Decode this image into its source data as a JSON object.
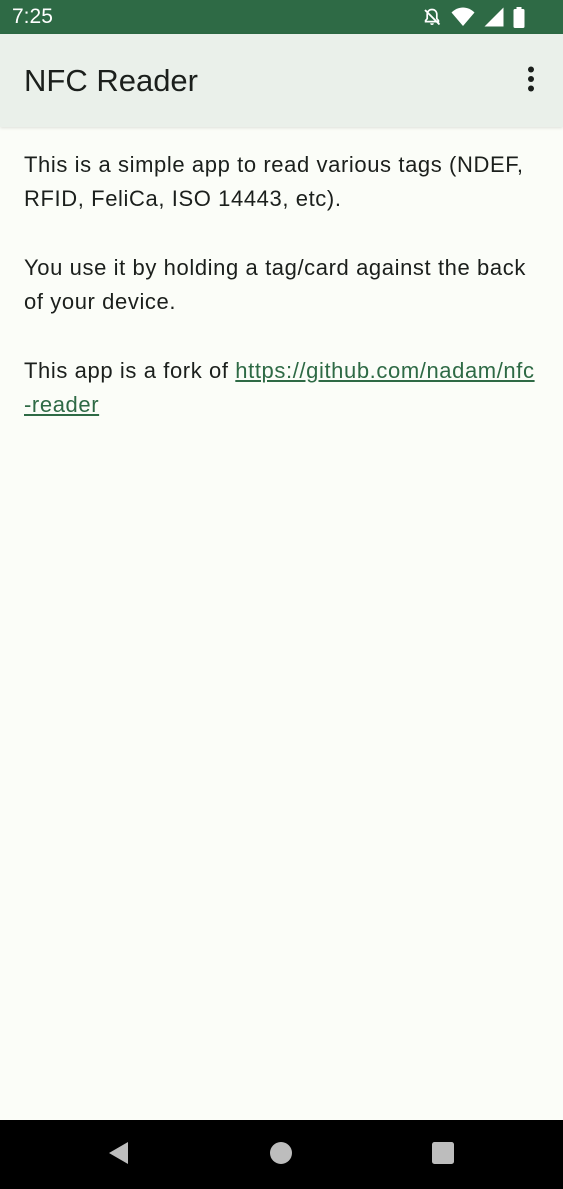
{
  "status_bar": {
    "time": "7:25",
    "icons": [
      "notifications-off-icon",
      "wifi-icon",
      "cell-signal-icon",
      "battery-icon"
    ]
  },
  "app_bar": {
    "title": "NFC Reader",
    "overflow_icon": "more-vert-icon"
  },
  "content": {
    "paragraph_1": "This is a simple app to read various tags (NDEF, RFID, FeliCa, ISO 14443, etc).",
    "paragraph_2": "You use it by holding a tag/card against the back of your device.",
    "paragraph_3_prefix": "This app is a fork of ",
    "paragraph_3_link": "https://github.com/nadam/nfc-reader"
  },
  "nav_bar": {
    "icons": [
      "back-icon",
      "home-icon",
      "recents-icon"
    ]
  },
  "colors": {
    "status_bar": "#2e6a45",
    "app_bar": "#eaf0ea",
    "background": "#fbfdf8",
    "link": "#2e6a45",
    "text": "#1b1f1c",
    "nav_bar": "#000000"
  }
}
